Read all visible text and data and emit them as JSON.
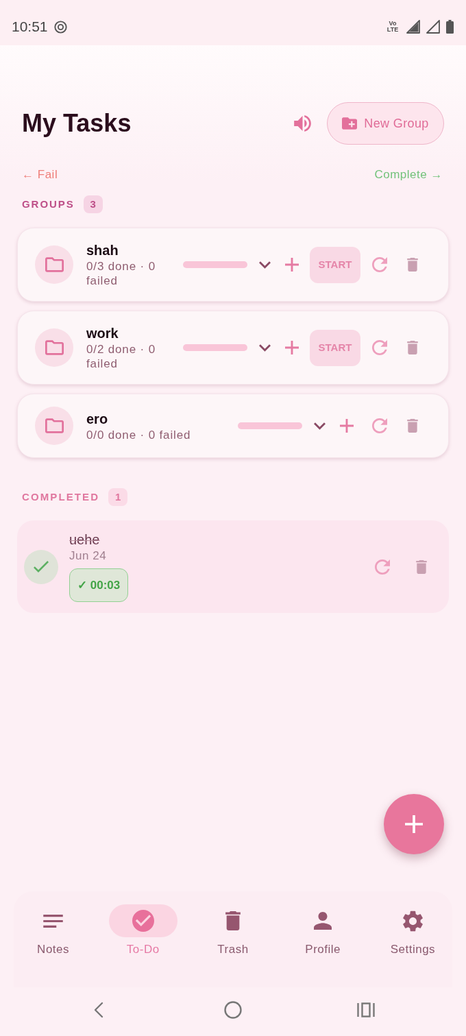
{
  "status_bar": {
    "time": "10:51",
    "network_badge": "Vo LTE"
  },
  "header": {
    "title": "My Tasks",
    "new_group_button": "New Group"
  },
  "swipe_hints": {
    "left": "← Fail",
    "right": "Complete →"
  },
  "groups": {
    "label": "GROUPS",
    "count": "3",
    "items": [
      {
        "name": "shah",
        "summary": "0/3 done · 0 failed",
        "start_button": "START"
      },
      {
        "name": "work",
        "summary": "0/2 done · 0 failed",
        "start_button": "START"
      },
      {
        "name": "ero",
        "summary": "0/0 done · 0 failed"
      }
    ]
  },
  "completed": {
    "label": "COMPLETED",
    "count": "1",
    "items": [
      {
        "title": "uehe",
        "date": "Jun 24",
        "timer": "✓ 00:03",
        "done": true
      }
    ]
  },
  "bottom_nav": [
    {
      "label": "Notes",
      "selected": false
    },
    {
      "label": "To-Do",
      "selected": true
    },
    {
      "label": "Trash",
      "selected": false
    },
    {
      "label": "Profile",
      "selected": false
    },
    {
      "label": "Settings",
      "selected": false
    }
  ]
}
